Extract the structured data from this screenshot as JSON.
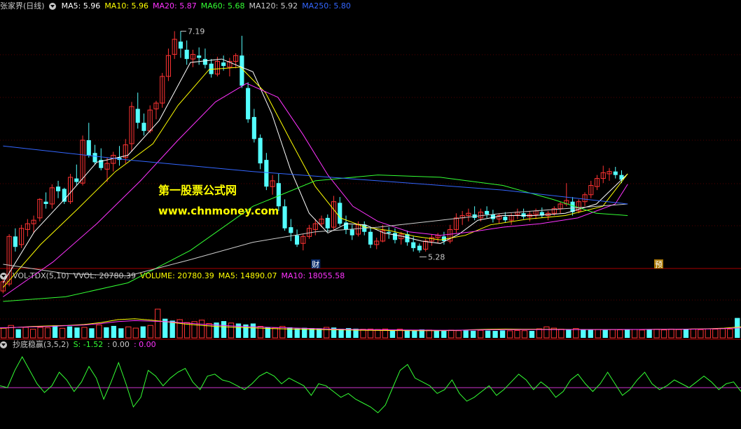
{
  "header": {
    "title": "张家界(日线)",
    "ma": [
      {
        "label": "MA5: 5.96",
        "color": "#ffffff"
      },
      {
        "label": "MA10: 5.96",
        "color": "#ffff00"
      },
      {
        "label": "MA20: 5.87",
        "color": "#ff33ff"
      },
      {
        "label": "MA60: 5.68",
        "color": "#33ff33"
      },
      {
        "label": "MA120: 5.92",
        "color": "#cccccc"
      },
      {
        "label": "MA250: 5.80",
        "color": "#3366ff"
      }
    ]
  },
  "volume_header": {
    "name": "VOL-TDX(5,10)",
    "items": [
      {
        "label": "VVOL: 20780.39",
        "color": "#cccccc"
      },
      {
        "label": "VOLUME: 20780.39",
        "color": "#ffff00"
      },
      {
        "label": "MA5: 14890.07",
        "color": "#ffff00"
      },
      {
        "label": "MA10: 18055.58",
        "color": "#ff33ff"
      }
    ]
  },
  "osc_header": {
    "name": "抄底稳赢(3,5,2)",
    "items": [
      {
        "label": "S: -1.52",
        "color": "#33ff33"
      },
      {
        "label": ": 0.00",
        "color": "#cccccc"
      },
      {
        "label": ": 0.00",
        "color": "#ff33ff"
      }
    ]
  },
  "watermark": {
    "line1": "第一股票公式网",
    "line2": "www.chnmoney.com"
  },
  "markers": {
    "cai": "财",
    "yu": "预",
    "high_label": "7.19",
    "low_label": "5.28"
  },
  "chart_data": {
    "type": "candlestick",
    "ylim": [
      5.15,
      7.35
    ],
    "bar_count": 121,
    "candles": [
      [
        4.95,
        5.05,
        4.93,
        5.03
      ],
      [
        5.01,
        5.44,
        4.99,
        5.42
      ],
      [
        5.42,
        5.49,
        5.29,
        5.33
      ],
      [
        5.35,
        5.52,
        5.32,
        5.49
      ],
      [
        5.48,
        5.57,
        5.42,
        5.53
      ],
      [
        5.53,
        5.6,
        5.45,
        5.56
      ],
      [
        5.58,
        5.75,
        5.55,
        5.74
      ],
      [
        5.72,
        5.8,
        5.66,
        5.7
      ],
      [
        5.7,
        5.87,
        5.66,
        5.84
      ],
      [
        5.85,
        5.9,
        5.75,
        5.81
      ],
      [
        5.83,
        5.84,
        5.7,
        5.72
      ],
      [
        5.72,
        5.96,
        5.7,
        5.93
      ],
      [
        5.92,
        6.04,
        5.86,
        5.89
      ],
      [
        5.88,
        6.29,
        5.86,
        6.25
      ],
      [
        6.25,
        6.4,
        6.1,
        6.12
      ],
      [
        6.14,
        6.21,
        6.04,
        6.06
      ],
      [
        6.08,
        6.18,
        5.99,
        6.01
      ],
      [
        6.0,
        6.1,
        5.89,
        6.05
      ],
      [
        6.05,
        6.15,
        5.98,
        6.12
      ],
      [
        6.1,
        6.2,
        6.03,
        6.08
      ],
      [
        6.1,
        6.26,
        6.05,
        6.21
      ],
      [
        6.22,
        6.58,
        6.15,
        6.54
      ],
      [
        6.52,
        6.66,
        6.35,
        6.4
      ],
      [
        6.4,
        6.48,
        6.29,
        6.33
      ],
      [
        6.33,
        6.55,
        6.31,
        6.51
      ],
      [
        6.52,
        6.59,
        6.43,
        6.57
      ],
      [
        6.57,
        6.83,
        6.53,
        6.8
      ],
      [
        6.8,
        7.04,
        6.76,
        6.98
      ],
      [
        6.99,
        7.19,
        6.95,
        7.12
      ],
      [
        7.1,
        7.19,
        6.96,
        7.04
      ],
      [
        7.03,
        7.11,
        6.9,
        6.95
      ],
      [
        6.95,
        7.03,
        6.88,
        6.99
      ],
      [
        6.98,
        7.05,
        6.9,
        6.96
      ],
      [
        6.95,
        7.04,
        6.87,
        6.9
      ],
      [
        6.91,
        6.95,
        6.79,
        6.82
      ],
      [
        6.82,
        6.97,
        6.8,
        6.93
      ],
      [
        6.92,
        6.98,
        6.85,
        6.89
      ],
      [
        6.88,
        6.96,
        6.8,
        6.93
      ],
      [
        6.93,
        7.0,
        6.87,
        6.98
      ],
      [
        6.98,
        7.15,
        6.7,
        6.72
      ],
      [
        6.7,
        6.75,
        6.4,
        6.43
      ],
      [
        6.45,
        6.52,
        6.23,
        6.26
      ],
      [
        6.27,
        6.3,
        6.0,
        6.05
      ],
      [
        6.08,
        6.14,
        5.82,
        5.85
      ],
      [
        5.85,
        5.95,
        5.78,
        5.9
      ],
      [
        5.88,
        5.96,
        5.64,
        5.68
      ],
      [
        5.68,
        5.74,
        5.47,
        5.49
      ],
      [
        5.5,
        5.57,
        5.38,
        5.45
      ],
      [
        5.43,
        5.48,
        5.33,
        5.35
      ],
      [
        5.36,
        5.44,
        5.3,
        5.42
      ],
      [
        5.42,
        5.52,
        5.4,
        5.49
      ],
      [
        5.48,
        5.57,
        5.43,
        5.53
      ],
      [
        5.53,
        5.6,
        5.5,
        5.57
      ],
      [
        5.58,
        5.61,
        5.46,
        5.49
      ],
      [
        5.5,
        5.77,
        5.48,
        5.72
      ],
      [
        5.71,
        5.76,
        5.51,
        5.53
      ],
      [
        5.54,
        5.6,
        5.44,
        5.48
      ],
      [
        5.48,
        5.52,
        5.39,
        5.43
      ],
      [
        5.44,
        5.55,
        5.42,
        5.52
      ],
      [
        5.52,
        5.55,
        5.43,
        5.46
      ],
      [
        5.46,
        5.5,
        5.32,
        5.35
      ],
      [
        5.35,
        5.41,
        5.31,
        5.38
      ],
      [
        5.38,
        5.52,
        5.37,
        5.47
      ],
      [
        5.46,
        5.5,
        5.4,
        5.45
      ],
      [
        5.45,
        5.49,
        5.36,
        5.39
      ],
      [
        5.4,
        5.46,
        5.35,
        5.44
      ],
      [
        5.44,
        5.47,
        5.34,
        5.37
      ],
      [
        5.37,
        5.42,
        5.29,
        5.32
      ],
      [
        5.34,
        5.36,
        5.28,
        5.3
      ],
      [
        5.31,
        5.4,
        5.29,
        5.38
      ],
      [
        5.38,
        5.44,
        5.34,
        5.41
      ],
      [
        5.41,
        5.45,
        5.36,
        5.43
      ],
      [
        5.42,
        5.46,
        5.35,
        5.38
      ],
      [
        5.38,
        5.52,
        5.36,
        5.48
      ],
      [
        5.48,
        5.62,
        5.45,
        5.58
      ],
      [
        5.58,
        5.64,
        5.52,
        5.6
      ],
      [
        5.6,
        5.66,
        5.55,
        5.62
      ],
      [
        5.61,
        5.68,
        5.56,
        5.58
      ],
      [
        5.58,
        5.66,
        5.55,
        5.63
      ],
      [
        5.64,
        5.68,
        5.58,
        5.61
      ],
      [
        5.61,
        5.65,
        5.54,
        5.57
      ],
      [
        5.57,
        5.62,
        5.53,
        5.6
      ],
      [
        5.59,
        5.63,
        5.54,
        5.56
      ],
      [
        5.56,
        5.62,
        5.52,
        5.6
      ],
      [
        5.61,
        5.66,
        5.57,
        5.63
      ],
      [
        5.62,
        5.66,
        5.57,
        5.59
      ],
      [
        5.59,
        5.64,
        5.55,
        5.61
      ],
      [
        5.61,
        5.66,
        5.57,
        5.64
      ],
      [
        5.63,
        5.67,
        5.58,
        5.6
      ],
      [
        5.6,
        5.64,
        5.56,
        5.62
      ],
      [
        5.62,
        5.68,
        5.6,
        5.66
      ],
      [
        5.66,
        5.72,
        5.62,
        5.7
      ],
      [
        5.7,
        5.88,
        5.68,
        5.73
      ],
      [
        5.72,
        5.76,
        5.6,
        5.63
      ],
      [
        5.64,
        5.74,
        5.62,
        5.72
      ],
      [
        5.72,
        5.8,
        5.68,
        5.78
      ],
      [
        5.78,
        5.9,
        5.75,
        5.86
      ],
      [
        5.85,
        5.95,
        5.82,
        5.92
      ],
      [
        5.92,
        6.03,
        5.88,
        5.97
      ],
      [
        5.96,
        6.01,
        5.9,
        5.98
      ],
      [
        5.98,
        6.02,
        5.92,
        5.95
      ],
      [
        5.95,
        5.99,
        5.88,
        5.91
      ]
    ],
    "ma_lines": [
      {
        "name": "MA5",
        "color": "#ffffff",
        "points": [
          [
            0,
            5.02
          ],
          [
            5,
            5.46
          ],
          [
            10,
            5.75
          ],
          [
            15,
            6.06
          ],
          [
            20,
            6.12
          ],
          [
            25,
            6.42
          ],
          [
            30,
            6.92
          ],
          [
            35,
            6.95
          ],
          [
            40,
            6.84
          ],
          [
            43,
            6.48
          ],
          [
            46,
            6.0
          ],
          [
            49,
            5.62
          ],
          [
            52,
            5.45
          ],
          [
            55,
            5.53
          ],
          [
            58,
            5.52
          ],
          [
            61,
            5.45
          ],
          [
            64,
            5.42
          ],
          [
            67,
            5.38
          ],
          [
            70,
            5.36
          ],
          [
            73,
            5.44
          ],
          [
            76,
            5.56
          ],
          [
            80,
            5.6
          ],
          [
            85,
            5.6
          ],
          [
            90,
            5.62
          ],
          [
            95,
            5.7
          ],
          [
            100,
            5.96
          ]
        ]
      },
      {
        "name": "MA10",
        "color": "#ffff00",
        "points": [
          [
            0,
            4.98
          ],
          [
            6,
            5.35
          ],
          [
            12,
            5.66
          ],
          [
            18,
            5.98
          ],
          [
            24,
            6.22
          ],
          [
            28,
            6.55
          ],
          [
            33,
            6.86
          ],
          [
            38,
            6.88
          ],
          [
            42,
            6.66
          ],
          [
            46,
            6.25
          ],
          [
            50,
            5.85
          ],
          [
            54,
            5.58
          ],
          [
            58,
            5.5
          ],
          [
            62,
            5.47
          ],
          [
            66,
            5.42
          ],
          [
            70,
            5.39
          ],
          [
            74,
            5.43
          ],
          [
            78,
            5.52
          ],
          [
            84,
            5.57
          ],
          [
            90,
            5.6
          ],
          [
            96,
            5.68
          ],
          [
            100,
            5.96
          ]
        ]
      },
      {
        "name": "MA20",
        "color": "#ff33ff",
        "points": [
          [
            0,
            4.9
          ],
          [
            8,
            5.2
          ],
          [
            15,
            5.53
          ],
          [
            22,
            5.9
          ],
          [
            28,
            6.25
          ],
          [
            34,
            6.58
          ],
          [
            39,
            6.74
          ],
          [
            44,
            6.62
          ],
          [
            48,
            6.3
          ],
          [
            52,
            5.95
          ],
          [
            56,
            5.68
          ],
          [
            60,
            5.55
          ],
          [
            65,
            5.46
          ],
          [
            70,
            5.43
          ],
          [
            75,
            5.46
          ],
          [
            80,
            5.5
          ],
          [
            86,
            5.53
          ],
          [
            92,
            5.58
          ],
          [
            98,
            5.7
          ],
          [
            100,
            5.87
          ]
        ]
      },
      {
        "name": "MA60",
        "color": "#33ff33",
        "points": [
          [
            0,
            4.86
          ],
          [
            10,
            4.9
          ],
          [
            20,
            5.02
          ],
          [
            30,
            5.3
          ],
          [
            40,
            5.68
          ],
          [
            50,
            5.9
          ],
          [
            60,
            5.95
          ],
          [
            70,
            5.93
          ],
          [
            80,
            5.86
          ],
          [
            88,
            5.74
          ],
          [
            95,
            5.62
          ],
          [
            100,
            5.6
          ]
        ]
      },
      {
        "name": "MA120",
        "color": "#cccccc",
        "points": [
          [
            0,
            5.18
          ],
          [
            10,
            5.1
          ],
          [
            20,
            5.08
          ],
          [
            30,
            5.22
          ],
          [
            40,
            5.37
          ],
          [
            50,
            5.46
          ],
          [
            60,
            5.5
          ],
          [
            70,
            5.56
          ],
          [
            80,
            5.62
          ],
          [
            90,
            5.66
          ],
          [
            100,
            5.7
          ]
        ]
      },
      {
        "name": "MA250",
        "color": "#3366ff",
        "points": [
          [
            0,
            6.2
          ],
          [
            20,
            6.08
          ],
          [
            40,
            5.98
          ],
          [
            60,
            5.9
          ],
          [
            80,
            5.82
          ],
          [
            100,
            5.7
          ]
        ]
      }
    ],
    "volume": {
      "ylim": [
        0,
        60000
      ],
      "bars": [
        10000,
        13000,
        9000,
        11000,
        9000,
        11000,
        10500,
        13000,
        10000,
        12000,
        10800,
        11000,
        10000,
        13500,
        11000,
        12500,
        10000,
        11500,
        10200,
        12000,
        13000,
        30000,
        20000,
        18000,
        19000,
        16000,
        17000,
        18500,
        15000,
        16000,
        17500,
        15500,
        15000,
        14000,
        15000,
        12000,
        11000,
        10500,
        12000,
        11000,
        9800,
        10500,
        10200,
        10000,
        11000,
        10800,
        9500,
        10200,
        9600,
        9000,
        9200,
        8800,
        9300,
        8600,
        9100,
        8400,
        8300,
        8800,
        8200,
        8000,
        7600,
        8100,
        7500,
        7700,
        7400,
        7900,
        7600,
        7300,
        7800,
        7400,
        7700,
        7500,
        7300,
        9500,
        11500,
        10200,
        9100,
        8600,
        9800,
        8900,
        8500,
        8800,
        8300,
        8700,
        8400,
        8600,
        8800,
        8200,
        8500,
        9000,
        8300,
        9200,
        8700,
        8900,
        9300,
        8600,
        9400,
        9100,
        9600,
        9200,
        20780
      ],
      "ma5": [
        10000,
        11000,
        12000,
        12500,
        13000,
        14000,
        16000,
        19000,
        20000,
        18500,
        16500,
        14500,
        13000,
        11800,
        11000,
        10400,
        9800,
        9400,
        9000,
        8700,
        8400,
        8100,
        7900,
        7700,
        7600,
        7550,
        7500,
        7700,
        8500,
        9000,
        9200,
        9100,
        9000,
        8900,
        8800,
        8700,
        8700,
        8700,
        8800,
        8900,
        9000,
        9200,
        9500,
        10200,
        11500
      ],
      "ma10": [
        10500,
        11000,
        11500,
        12000,
        12800,
        13500,
        15000,
        17000,
        18000,
        17500,
        16800,
        15500,
        14300,
        13200,
        12300,
        11600,
        11000,
        10500,
        10000,
        9500,
        9100,
        8800,
        8600,
        8400,
        8200,
        8100,
        8000,
        8000,
        8200,
        8400,
        8600,
        8700,
        8700,
        8700,
        8700,
        8700,
        8700,
        8750,
        8800,
        8850,
        8950,
        9100,
        9300,
        9700,
        10500
      ]
    },
    "oscillator": {
      "ylim": [
        -4,
        4
      ],
      "zero": 0,
      "values": [
        0.2,
        0.0,
        1.8,
        3.2,
        1.8,
        0.4,
        -0.5,
        0.2,
        1.6,
        0.8,
        -0.4,
        0.6,
        2.2,
        1.0,
        -1.2,
        0.6,
        2.6,
        0.4,
        -2.0,
        -1.0,
        1.8,
        1.2,
        0.2,
        1.0,
        1.6,
        2.0,
        0.6,
        -0.2,
        1.2,
        1.4,
        0.8,
        0.6,
        0.2,
        -0.2,
        0.4,
        1.2,
        1.6,
        1.2,
        0.4,
        1.0,
        0.6,
        0.2,
        -0.8,
        0.4,
        0.2,
        -0.4,
        -1.0,
        -0.6,
        -1.2,
        -1.6,
        -2.0,
        -2.6,
        -1.8,
        0.0,
        1.8,
        2.4,
        1.0,
        0.6,
        0.2,
        -0.6,
        -0.2,
        0.8,
        -0.6,
        -1.4,
        -1.0,
        -0.4,
        0.2,
        -0.8,
        -0.2,
        0.6,
        1.4,
        0.8,
        -0.2,
        0.6,
        0.0,
        -1.0,
        -0.4,
        0.8,
        1.4,
        0.4,
        -0.4,
        0.4,
        1.6,
        0.4,
        -0.8,
        -0.2,
        0.8,
        1.6,
        0.4,
        -0.2,
        0.2,
        0.8,
        0.4,
        0.0,
        0.6,
        1.2,
        0.6,
        -0.2,
        0.4,
        0.6,
        -0.4
      ]
    }
  }
}
